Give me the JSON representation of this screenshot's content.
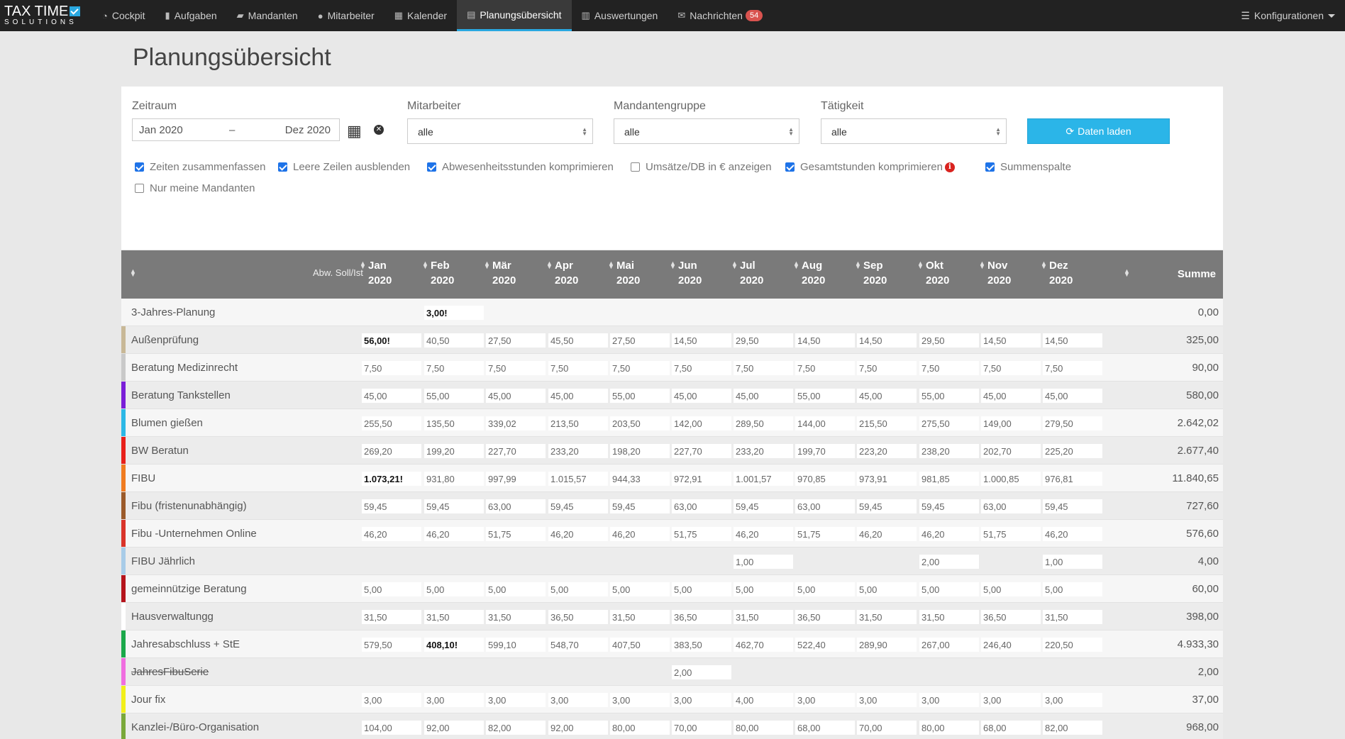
{
  "nav": {
    "brand_line1": "TAX TIME",
    "brand_line2": "SOLUTIONS",
    "items": [
      {
        "icon": "dashboard-icon",
        "glyph": "◔",
        "label": "Cockpit"
      },
      {
        "icon": "bookmark-icon",
        "glyph": "▮",
        "label": "Aufgaben"
      },
      {
        "icon": "folder-open-icon",
        "glyph": "▰",
        "label": "Mandanten"
      },
      {
        "icon": "users-icon",
        "glyph": "●",
        "label": "Mitarbeiter"
      },
      {
        "icon": "calendar-icon",
        "glyph": "▦",
        "label": "Kalender"
      },
      {
        "icon": "list-alt-icon",
        "glyph": "▤",
        "label": "Planungsübersicht",
        "active": true
      },
      {
        "icon": "bar-chart-icon",
        "glyph": "▥",
        "label": "Auswertungen"
      },
      {
        "icon": "envelope-icon",
        "glyph": "✉",
        "label": "Nachrichten",
        "badge": "54"
      }
    ],
    "right_label": "Konfigurationen"
  },
  "page_title": "Planungsübersicht",
  "filters": {
    "zeitraum_label": "Zeitraum",
    "date_from": "Jan 2020",
    "date_sep": "–",
    "date_to": "Dez 2020",
    "mitarbeiter_label": "Mitarbeiter",
    "mitarbeiter_value": "alle",
    "mandantengruppe_label": "Mandantengruppe",
    "mandantengruppe_value": "alle",
    "taetigkeit_label": "Tätigkeit",
    "taetigkeit_value": "alle",
    "load_button": "Daten laden",
    "checkboxes": [
      {
        "label": "Zeiten zusammenfassen",
        "checked": true
      },
      {
        "label": "Leere Zeilen ausblenden",
        "checked": true
      },
      {
        "label": "Abwesenheitsstunden komprimieren",
        "checked": true
      },
      {
        "label": "Umsätze/DB in € anzeigen",
        "checked": false
      },
      {
        "label": "Gesamtstunden komprimieren",
        "checked": true
      },
      {
        "label": "Summenspalte",
        "checked": true
      },
      {
        "label": "Nur meine Mandanten",
        "checked": false
      }
    ]
  },
  "table": {
    "abw_label": "Abw. Soll/Ist",
    "months": [
      {
        "m": "Jan",
        "y": "2020"
      },
      {
        "m": "Feb",
        "y": "2020"
      },
      {
        "m": "Mär",
        "y": "2020"
      },
      {
        "m": "Apr",
        "y": "2020"
      },
      {
        "m": "Mai",
        "y": "2020"
      },
      {
        "m": "Jun",
        "y": "2020"
      },
      {
        "m": "Jul",
        "y": "2020"
      },
      {
        "m": "Aug",
        "y": "2020"
      },
      {
        "m": "Sep",
        "y": "2020"
      },
      {
        "m": "Okt",
        "y": "2020"
      },
      {
        "m": "Nov",
        "y": "2020"
      },
      {
        "m": "Dez",
        "y": "2020"
      }
    ],
    "sum_label": "Summe",
    "rows": [
      {
        "name": "3-Jahres-Planung",
        "color": "",
        "values": [
          "",
          "3,00!",
          "",
          "",
          "",
          "",
          "",
          "",
          "",
          "",
          "",
          ""
        ],
        "bold": [
          1
        ],
        "sum": "0,00"
      },
      {
        "name": "Außenprüfung",
        "color": "#c8b896",
        "values": [
          "56,00!",
          "40,50",
          "27,50",
          "45,50",
          "27,50",
          "14,50",
          "29,50",
          "14,50",
          "14,50",
          "29,50",
          "14,50",
          "14,50"
        ],
        "bold": [
          0
        ],
        "sum": "325,00"
      },
      {
        "name": "Beratung Medizinrecht",
        "color": "#c9c9c9",
        "values": [
          "7,50",
          "7,50",
          "7,50",
          "7,50",
          "7,50",
          "7,50",
          "7,50",
          "7,50",
          "7,50",
          "7,50",
          "7,50",
          "7,50"
        ],
        "bold": [],
        "sum": "90,00"
      },
      {
        "name": "Beratung Tankstellen",
        "color": "#7a1fd8",
        "values": [
          "45,00",
          "55,00",
          "45,00",
          "45,00",
          "55,00",
          "45,00",
          "45,00",
          "55,00",
          "45,00",
          "55,00",
          "45,00",
          "45,00"
        ],
        "bold": [],
        "sum": "580,00"
      },
      {
        "name": "Blumen gießen",
        "color": "#2cb8e6",
        "values": [
          "255,50",
          "135,50",
          "339,02",
          "213,50",
          "203,50",
          "142,00",
          "289,50",
          "144,00",
          "215,50",
          "275,50",
          "149,00",
          "279,50"
        ],
        "bold": [],
        "sum": "2.642,02"
      },
      {
        "name": "BW Beratun",
        "color": "#e8201a",
        "values": [
          "269,20",
          "199,20",
          "227,70",
          "233,20",
          "198,20",
          "227,70",
          "233,20",
          "199,70",
          "223,20",
          "238,20",
          "202,70",
          "225,20"
        ],
        "bold": [],
        "sum": "2.677,40"
      },
      {
        "name": "FIBU",
        "color": "#f07b20",
        "values": [
          "1.073,21!",
          "931,80",
          "997,99",
          "1.015,57",
          "944,33",
          "972,91",
          "1.001,57",
          "970,85",
          "973,91",
          "981,85",
          "1.000,85",
          "976,81"
        ],
        "bold": [
          0
        ],
        "sum": "11.840,65"
      },
      {
        "name": "Fibu (fristenunabhängig)",
        "color": "#9b5a2a",
        "values": [
          "59,45",
          "59,45",
          "63,00",
          "59,45",
          "59,45",
          "63,00",
          "59,45",
          "63,00",
          "59,45",
          "59,45",
          "63,00",
          "59,45"
        ],
        "bold": [],
        "sum": "727,60"
      },
      {
        "name": "Fibu -Unternehmen Online",
        "color": "#d9342a",
        "values": [
          "46,20",
          "46,20",
          "51,75",
          "46,20",
          "46,20",
          "51,75",
          "46,20",
          "51,75",
          "46,20",
          "46,20",
          "51,75",
          "46,20"
        ],
        "bold": [],
        "sum": "576,60"
      },
      {
        "name": "FIBU Jährlich",
        "color": "#a8cce8",
        "values": [
          "",
          "",
          "",
          "",
          "",
          "",
          "1,00",
          "",
          "",
          "2,00",
          "",
          "1,00"
        ],
        "bold": [],
        "sum": "4,00"
      },
      {
        "name": "gemeinnützige Beratung",
        "color": "#b5141c",
        "values": [
          "5,00",
          "5,00",
          "5,00",
          "5,00",
          "5,00",
          "5,00",
          "5,00",
          "5,00",
          "5,00",
          "5,00",
          "5,00",
          "5,00"
        ],
        "bold": [],
        "sum": "60,00"
      },
      {
        "name": "Hausverwaltungg",
        "color": "#ffffff",
        "values": [
          "31,50",
          "31,50",
          "31,50",
          "36,50",
          "31,50",
          "36,50",
          "31,50",
          "36,50",
          "31,50",
          "31,50",
          "36,50",
          "31,50"
        ],
        "bold": [],
        "sum": "398,00"
      },
      {
        "name": "Jahresabschluss + StE",
        "color": "#1aa84a",
        "values": [
          "579,50",
          "408,10!",
          "599,10",
          "548,70",
          "407,50",
          "383,50",
          "462,70",
          "522,40",
          "289,90",
          "267,00",
          "246,40",
          "220,50"
        ],
        "bold": [
          1
        ],
        "sum": "4.933,30"
      },
      {
        "name": "JahresFibuSerie",
        "color": "#f06ee0",
        "strike": true,
        "values": [
          "",
          "",
          "",
          "",
          "",
          "2,00",
          "",
          "",
          "",
          "",
          "",
          ""
        ],
        "bold": [],
        "sum": "2,00"
      },
      {
        "name": "Jour fix",
        "color": "#f2ef1a",
        "values": [
          "3,00",
          "3,00",
          "3,00",
          "3,00",
          "3,00",
          "3,00",
          "4,00",
          "3,00",
          "3,00",
          "3,00",
          "3,00",
          "3,00"
        ],
        "bold": [],
        "sum": "37,00"
      },
      {
        "name": "Kanzlei-/Büro-Organisation",
        "color": "#7aa83a",
        "values": [
          "104,00",
          "92,00",
          "82,00",
          "92,00",
          "80,00",
          "70,00",
          "80,00",
          "68,00",
          "70,00",
          "80,00",
          "68,00",
          "82,00"
        ],
        "bold": [],
        "sum": "968,00"
      }
    ]
  }
}
